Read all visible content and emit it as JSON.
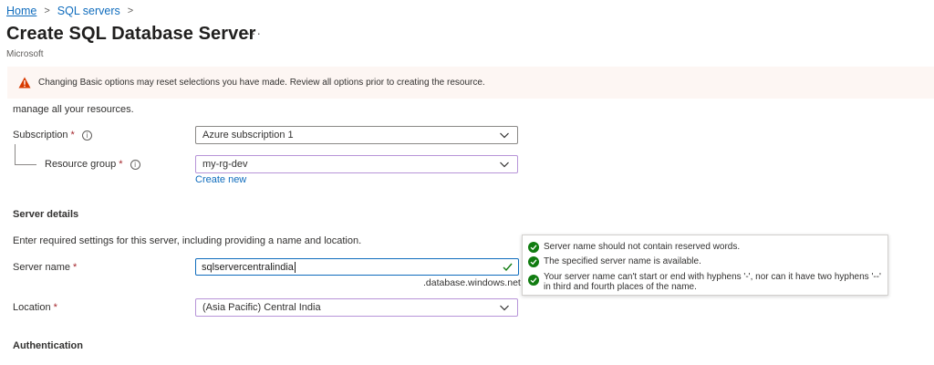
{
  "breadcrumb": {
    "home": "Home",
    "sql_servers": "SQL servers",
    "separator": ">"
  },
  "header": {
    "title": "Create SQL Database Server",
    "more": "···",
    "publisher": "Microsoft"
  },
  "warning": {
    "text": "Changing Basic options may reset selections you have made. Review all options prior to creating the resource.",
    "icon": "warning-icon",
    "color": "#d83b01"
  },
  "intro_tail": "manage all your resources.",
  "project": {
    "subscription_label": "Subscription",
    "subscription_value": "Azure subscription 1",
    "resource_group_label": "Resource group",
    "resource_group_value": "my-rg-dev",
    "create_new": "Create new"
  },
  "server_details": {
    "heading": "Server details",
    "description": "Enter required settings for this server, including providing a name and location.",
    "server_name_label": "Server name",
    "server_name_value": "sqlservercentralindia",
    "suffix": ".database.windows.net",
    "location_label": "Location",
    "location_value": "(Asia Pacific) Central India"
  },
  "validation": {
    "rule1": "Server name should not contain reserved words.",
    "rule2": "The specified server name is available.",
    "rule3": "Your server name can't start or end with hyphens '-', nor can it have two hyphens '--' in third and fourth places of the name.",
    "ok_color": "#107c10"
  },
  "authentication": {
    "heading": "Authentication"
  },
  "required_marker": "*",
  "info_glyph": "i"
}
